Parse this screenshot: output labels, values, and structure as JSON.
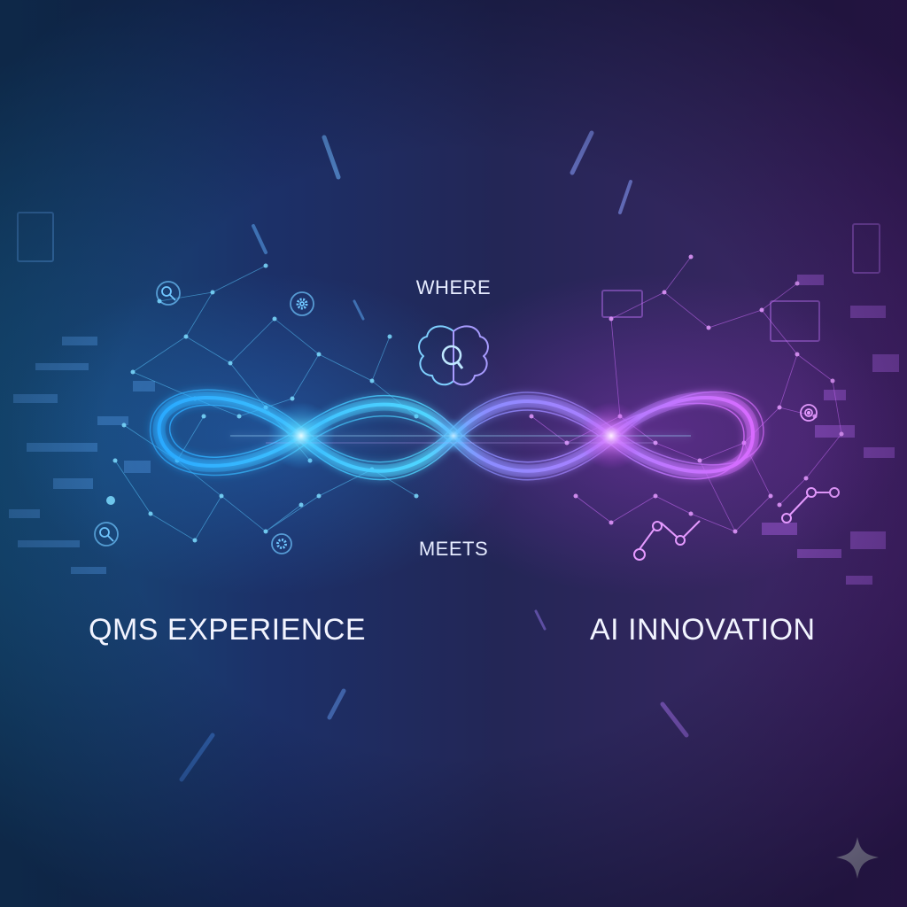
{
  "headline": {
    "top_word": "WHERE",
    "middle_word": "MEETS",
    "left_phrase": "QMS EXPERIENCE",
    "right_phrase": "AI INNOVATION"
  },
  "icons": {
    "center": "brain-with-magnifier-icon",
    "left_side": [
      "magnifier-icon",
      "gear-icon",
      "magnifier-icon",
      "gear-icon"
    ],
    "right_side": [
      "target-icon",
      "robotic-arm-icon"
    ],
    "corner": "sparkle-star-icon"
  },
  "colors": {
    "background_left": "#15507c",
    "background_right": "#45216a",
    "loop_cyan": "#4fd6ff",
    "loop_magenta": "#d86bff",
    "text": "#e6ecff"
  }
}
